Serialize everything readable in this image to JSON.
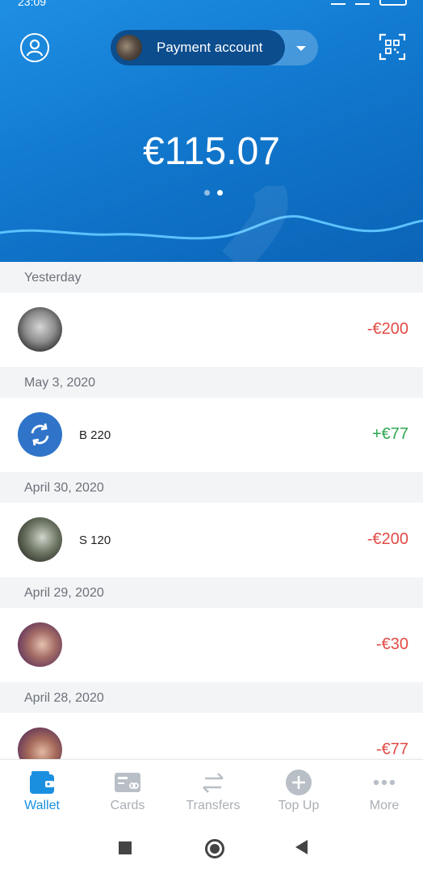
{
  "status_bar": {
    "time": "23:09"
  },
  "header": {
    "account_label": "Payment account",
    "balance": "€115.07"
  },
  "transactions": [
    {
      "date": "Yesterday",
      "name": "",
      "amount": "-€200",
      "direction": "negative",
      "avatar_icon": "user-photo"
    },
    {
      "date": "May 3, 2020",
      "name": "B 220",
      "amount": "+€77",
      "direction": "positive",
      "avatar_icon": "swap-arrows-icon"
    },
    {
      "date": "April 30, 2020",
      "name": "S 120",
      "amount": "-€200",
      "direction": "negative",
      "avatar_icon": "user-photo"
    },
    {
      "date": "April 29, 2020",
      "name": "",
      "amount": "-€30",
      "direction": "negative",
      "avatar_icon": "user-photo"
    },
    {
      "date": "April 28, 2020",
      "name": "",
      "amount": "-€77",
      "direction": "negative",
      "avatar_icon": "user-photo"
    }
  ],
  "bottom_nav": {
    "items": [
      {
        "label": "Wallet",
        "icon": "wallet-icon",
        "active": true
      },
      {
        "label": "Cards",
        "icon": "card-icon",
        "active": false
      },
      {
        "label": "Transfers",
        "icon": "transfer-arrows-icon",
        "active": false
      },
      {
        "label": "Top Up",
        "icon": "plus-circle-icon",
        "active": false
      },
      {
        "label": "More",
        "icon": "more-dots-icon",
        "active": false
      }
    ]
  },
  "colors": {
    "header_blue": "#1179cf",
    "accent": "#1a8fe0",
    "negative": "#e04b45",
    "positive": "#2fa84f"
  }
}
